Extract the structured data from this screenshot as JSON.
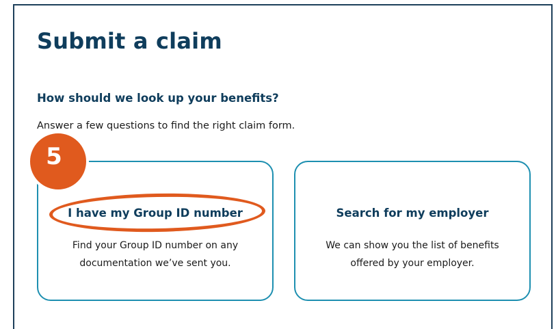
{
  "page": {
    "title": "Submit a claim",
    "question": "How should we look up your benefits?",
    "subtext": "Answer a few questions to find the right claim form."
  },
  "cards": [
    {
      "title": "I have my Group ID number",
      "description": "Find your Group ID number on any documentation we’ve sent you."
    },
    {
      "title": "Search for my employer",
      "description": "We can show you the list of benefits offered by your employer."
    }
  ],
  "annotation": {
    "step_number": "5",
    "color": "#e05a1e"
  },
  "colors": {
    "heading": "#0f3d5c",
    "card_border": "#1d8fb0",
    "frame_border": "#1d3f5a"
  }
}
